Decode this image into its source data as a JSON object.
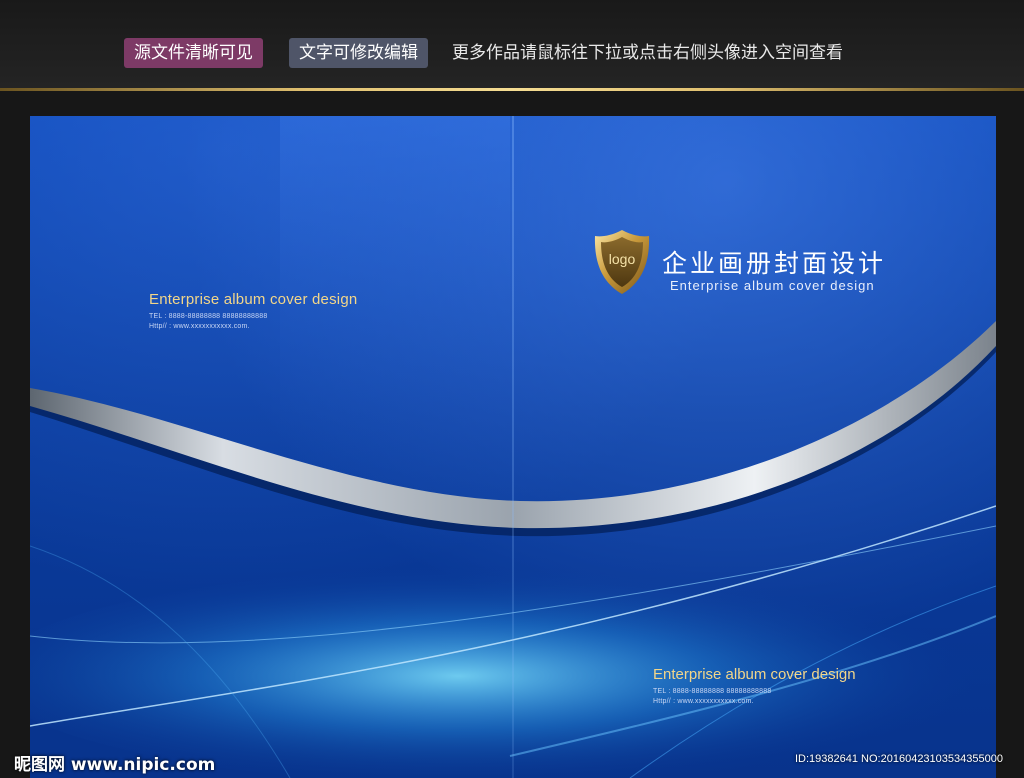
{
  "header": {
    "badge_source": "源文件清晰可见",
    "badge_editable": "文字可修改编辑",
    "hint": "更多作品请鼠标往下拉或点击右侧头像进入空间查看"
  },
  "back_cover": {
    "title_en": "Enterprise album cover design",
    "tel": "TEL : 8888-88888888  88888888888",
    "website": "Http// : www.xxxxxxxxxxx.com."
  },
  "front_cover": {
    "logo_text": "logo",
    "title_cn": "企业画册封面设计",
    "title_en": "Enterprise album cover design",
    "bottom_title_en": "Enterprise album cover design",
    "tel": "TEL : 8888-88888888  88888888888",
    "website": "Http// : www.xxxxxxxxxxx.com."
  },
  "watermark": {
    "site": "昵图网 www.nipic.com",
    "id_text": "ID:19382641 NO:20160423103534355000"
  },
  "colors": {
    "cover_blue": "#0a3c9e",
    "gold_accent": "#f2d68a",
    "badge_purple": "#7d3a66",
    "badge_gray": "#4f5568"
  },
  "icons": {
    "logo": "gold-shield-icon"
  }
}
